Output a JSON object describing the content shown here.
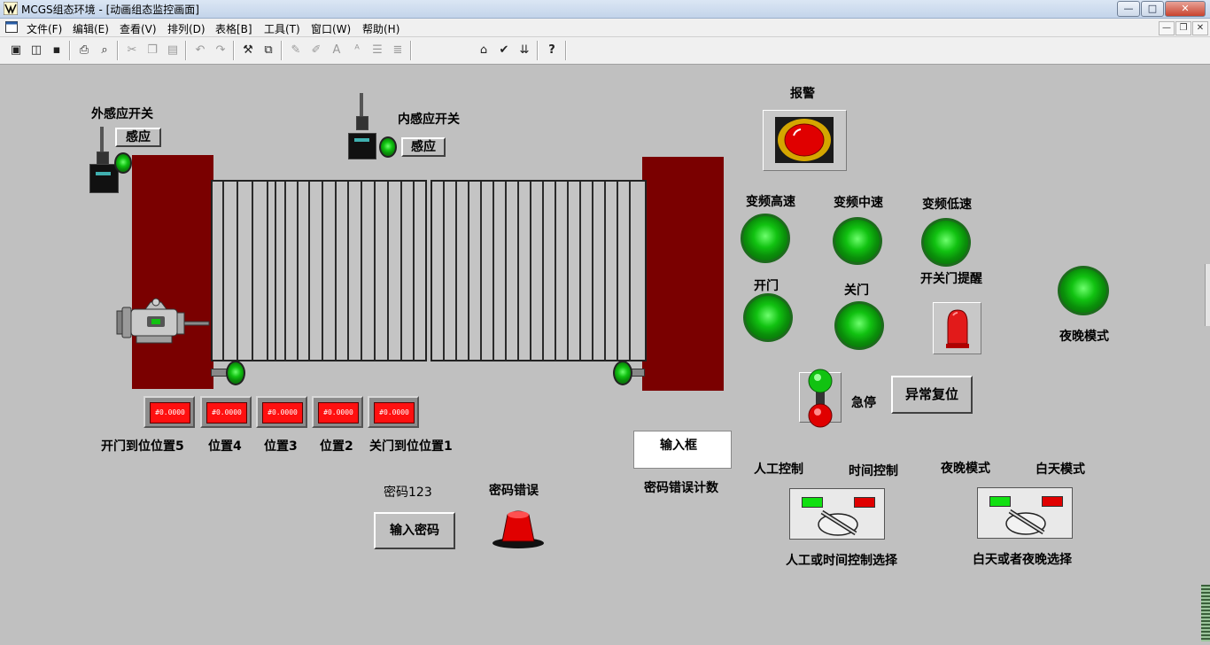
{
  "window": {
    "title": "MCGS组态环境 - [动画组态监控画面]",
    "controls": {
      "minimize": "—",
      "maximize": "□",
      "close": "✕"
    }
  },
  "menu": {
    "items": [
      "文件(F)",
      "编辑(E)",
      "查看(V)",
      "排列(D)",
      "表格[B]",
      "工具(T)",
      "窗口(W)",
      "帮助(H)"
    ],
    "mdi_controls": {
      "minimize": "—",
      "restore": "❐",
      "close": "✕"
    }
  },
  "toolbar": {
    "icons": [
      "new-window-icon",
      "open-icon",
      "save-icon",
      "print-icon",
      "print-preview-icon",
      "cut-icon",
      "copy-icon",
      "paste-icon",
      "undo-icon",
      "redo-icon",
      "tools-icon",
      "frame-icon",
      "edit-icon",
      "edit2-icon",
      "text-icon",
      "font-icon",
      "align-icon",
      "list-icon",
      "properties-icon",
      "check-icon",
      "download-icon",
      "help-icon"
    ]
  },
  "screen": {
    "outer_sensor_label": "外感应开关",
    "outer_sensor_button": "感应",
    "inner_sensor_label": "内感应开关",
    "inner_sensor_button": "感应",
    "position_display_text": "#0.0000",
    "position_labels": [
      "开门到位位置5",
      "位置4",
      "位置3",
      "位置2",
      "关门到位位置1"
    ],
    "password_label": "密码123",
    "password_error_label": "密码错误",
    "input_password_button": "输入密码",
    "input_box_label": "输入框",
    "password_error_count_label": "密码错误计数",
    "alarm_label": "报警",
    "freq_high_label": "变频高速",
    "freq_mid_label": "变频中速",
    "freq_low_label": "变频低速",
    "open_label": "开门",
    "close_label": "关门",
    "door_reminder_label": "开关门提醒",
    "night_mode_lamp_label": "夜晚模式",
    "estop_label": "急停",
    "reset_button": "异常复位",
    "manual_control_label": "人工控制",
    "time_control_label": "时间控制",
    "night_mode_label": "夜晚模式",
    "day_mode_label": "白天模式",
    "manual_time_select_label": "人工或时间控制选择",
    "day_night_select_label": "白天或者夜晚选择"
  },
  "colors": {
    "canvas": "#c0c0c0",
    "pillar": "#7a0000",
    "lamp_green": "#11c211",
    "alarm_red": "#e00000",
    "display_red": "#ff1010"
  }
}
